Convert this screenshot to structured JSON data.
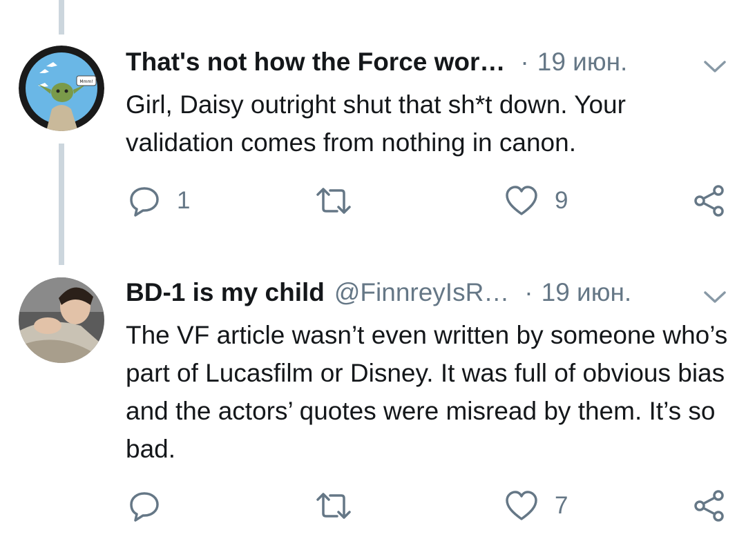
{
  "tweets": [
    {
      "name": "That's not how the Force wor…",
      "handle": "",
      "separator": "·",
      "date": "19 июн.",
      "text": "Girl, Daisy outright shut that sh*t down. Your validation comes from nothing in canon.",
      "avatar_badge": "Mmm!",
      "counts": {
        "reply": "1",
        "retweet": "",
        "like": "9"
      }
    },
    {
      "name": "BD-1 is my child",
      "handle": "@FinnreyIsR…",
      "separator": "·",
      "date": "19 июн.",
      "text": "The VF article wasn’t even written by someone who’s part of Lucasfilm or Disney. It was full of obvious bias and the actors’ quotes were misread by them. It’s so bad.",
      "counts": {
        "reply": "",
        "retweet": "",
        "like": "7"
      }
    }
  ],
  "icons": {
    "reply": "reply-icon",
    "retweet": "retweet-icon",
    "like": "heart-icon",
    "share": "share-icon",
    "menu": "chevron-down-icon"
  },
  "colors": {
    "text": "#14171a",
    "secondary": "#657786",
    "thread_line": "#ccd6dd"
  }
}
